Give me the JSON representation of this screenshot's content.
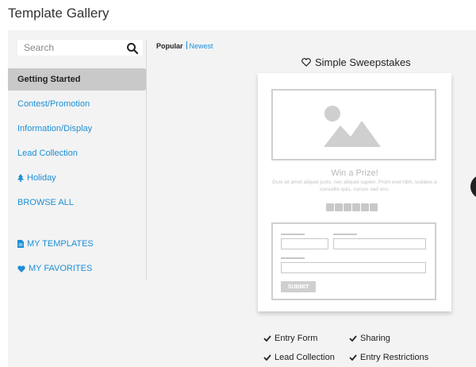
{
  "page": {
    "title": "Template Gallery"
  },
  "search": {
    "placeholder": "Search"
  },
  "nav": {
    "items": [
      {
        "label": "Getting Started"
      },
      {
        "label": "Contest/Promotion"
      },
      {
        "label": "Information/Display"
      },
      {
        "label": "Lead Collection"
      },
      {
        "label": "Holiday"
      },
      {
        "label": "BROWSE ALL"
      },
      {
        "label": "MY TEMPLATES"
      },
      {
        "label": "MY FAVORITES"
      }
    ]
  },
  "sort": {
    "popular": "Popular",
    "newest": "Newest"
  },
  "template": {
    "title": "Simple Sweepstakes",
    "preview": {
      "heading": "Win a Prize!",
      "body": "Duis sit amet aliquet justo, nec aliquet sapien. Proin erat nibh, sodales a convallis quis, cursus sed orci.",
      "submit": "SUBMIT"
    },
    "features": [
      "Entry Form",
      "Sharing",
      "Lead Collection",
      "Entry Restrictions"
    ]
  },
  "colors": {
    "link": "#1d8fd6",
    "active_bg": "#c9c9c9",
    "panel_bg": "#f3f3f3",
    "placeholder_gray": "#cfcfcf"
  },
  "icons": [
    "search-icon",
    "tree-icon",
    "document-icon",
    "heart-icon",
    "heart-outline-icon",
    "image-placeholder-icon",
    "checkmark-icon",
    "share-icon"
  ]
}
